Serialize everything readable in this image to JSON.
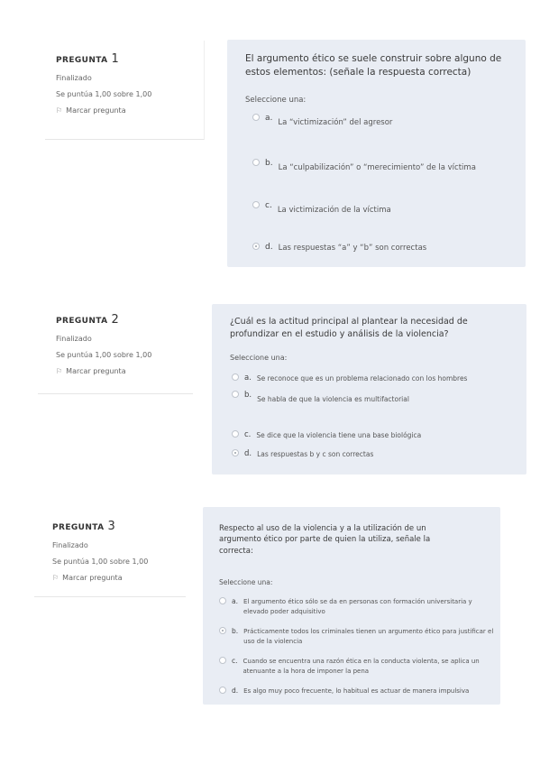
{
  "questions": [
    {
      "heading": "PREGUNTA",
      "number": "1",
      "status": "Finalizado",
      "score": "Se puntúa 1,00 sobre 1,00",
      "flag_label": "Marcar pregunta",
      "text": "El argumento ético se suele construir sobre alguno de estos elementos: (señale la respuesta correcta)",
      "prompt": "Seleccione una:",
      "options": [
        {
          "letter": "a.",
          "text": "La “victimización” del agresor",
          "checked": false
        },
        {
          "letter": "b.",
          "text": "La “culpabilización” o “merecimiento” de la víctima",
          "checked": false
        },
        {
          "letter": "c.",
          "text": "La victimización de la víctima",
          "checked": false
        },
        {
          "letter": "d.",
          "text": "Las respuestas “a” y “b” son correctas",
          "checked": true
        }
      ]
    },
    {
      "heading": "PREGUNTA",
      "number": "2",
      "status": "Finalizado",
      "score": "Se puntúa 1,00 sobre 1,00",
      "flag_label": "Marcar pregunta",
      "text": "¿Cuál es la actitud principal al plantear la necesidad de profundizar en el estudio y análisis de la violencia?",
      "prompt": "Seleccione una:",
      "options": [
        {
          "letter": "a.",
          "text": "Se reconoce que es un problema relacionado con los hombres",
          "checked": false
        },
        {
          "letter": "b.",
          "text": "Se habla de que la violencia es multifactorial",
          "checked": false
        },
        {
          "letter": "c.",
          "text": "Se dice que la violencia tiene una base biológica",
          "checked": false
        },
        {
          "letter": "d.",
          "text": "Las respuestas b y c son correctas",
          "checked": true
        }
      ]
    },
    {
      "heading": "PREGUNTA",
      "number": "3",
      "status": "Finalizado",
      "score": "Se puntúa 1,00 sobre 1,00",
      "flag_label": "Marcar pregunta",
      "text": "Respecto al uso de la violencia y a la utilización de un argumento ético por parte de quien la utiliza, señale la correcta:",
      "prompt": "Seleccione una:",
      "options": [
        {
          "letter": "a.",
          "text": "El argumento ético sólo se da en personas con formación universitaria y elevado poder adquisitivo",
          "checked": false
        },
        {
          "letter": "b.",
          "text": "Prácticamente todos los criminales tienen un argumento ético para justificar el uso de la violencia",
          "checked": true
        },
        {
          "letter": "c.",
          "text": "Cuando se encuentra una razón ética en la conducta violenta, se aplica un atenuante a la hora de imponer la pena",
          "checked": false
        },
        {
          "letter": "d.",
          "text": "Es algo muy poco frecuente, lo habitual es actuar de manera impulsiva",
          "checked": false
        }
      ]
    }
  ]
}
